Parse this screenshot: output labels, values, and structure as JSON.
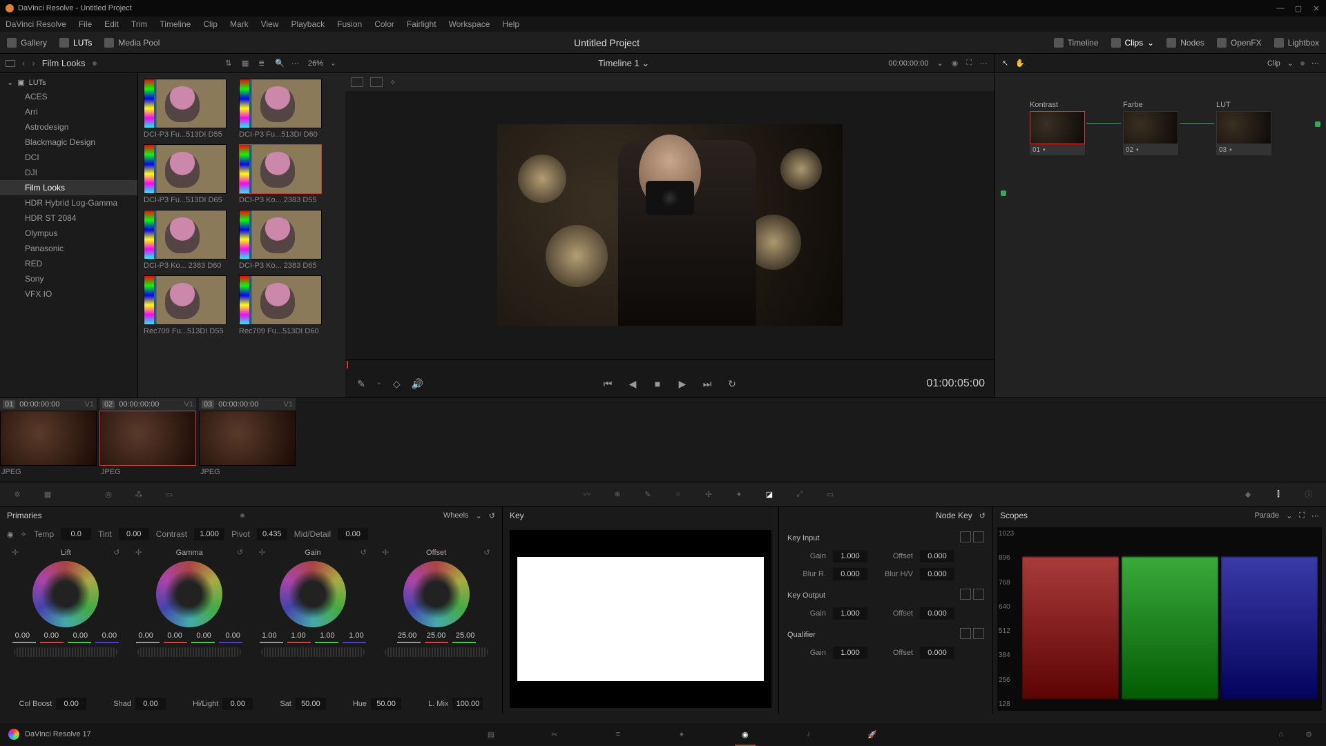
{
  "window": {
    "title": "DaVinci Resolve - Untitled Project"
  },
  "menus": [
    "DaVinci Resolve",
    "File",
    "Edit",
    "Trim",
    "Timeline",
    "Clip",
    "Mark",
    "View",
    "Playback",
    "Fusion",
    "Color",
    "Fairlight",
    "Workspace",
    "Help"
  ],
  "pagebar": {
    "left": [
      {
        "id": "gallery",
        "label": "Gallery"
      },
      {
        "id": "luts",
        "label": "LUTs",
        "active": true
      },
      {
        "id": "mediapool",
        "label": "Media Pool"
      }
    ],
    "title": "Untitled Project",
    "right": [
      {
        "id": "timeline",
        "label": "Timeline"
      },
      {
        "id": "clips",
        "label": "Clips",
        "active": true
      },
      {
        "id": "nodes",
        "label": "Nodes"
      },
      {
        "id": "openfx",
        "label": "OpenFX"
      },
      {
        "id": "lightbox",
        "label": "Lightbox"
      }
    ]
  },
  "luts": {
    "breadcrumb": "Film Looks",
    "zoom": "26%",
    "tree_root": "LUTs",
    "tree": [
      "ACES",
      "Arri",
      "Astrodesign",
      "Blackmagic Design",
      "DCI",
      "DJI",
      "Film Looks",
      "HDR Hybrid Log-Gamma",
      "HDR ST 2084",
      "Olympus",
      "Panasonic",
      "RED",
      "Sony",
      "VFX IO"
    ],
    "tree_selected": "Film Looks",
    "items": [
      {
        "label": "DCI-P3 Fu...513DI D55"
      },
      {
        "label": "DCI-P3 Fu...513DI D60"
      },
      {
        "label": "DCI-P3 Fu...513DI D65"
      },
      {
        "label": "DCI-P3 Ko... 2383 D55",
        "selected": true
      },
      {
        "label": "DCI-P3 Ko... 2383 D60"
      },
      {
        "label": "DCI-P3 Ko... 2383 D65"
      },
      {
        "label": "Rec709 Fu...513DI D55"
      },
      {
        "label": "Rec709 Fu...513DI D60"
      }
    ]
  },
  "viewer": {
    "timeline_name": "Timeline 1",
    "record_tc": "00:00:00:00",
    "timecode": "01:00:05:00"
  },
  "node_panel": {
    "mode": "Clip",
    "nodes": [
      {
        "num": "01",
        "label": "Kontrast",
        "selected": true
      },
      {
        "num": "02",
        "label": "Farbe"
      },
      {
        "num": "03",
        "label": "LUT"
      }
    ]
  },
  "clips": [
    {
      "num": "01",
      "tc": "00:00:00:00",
      "v": "V1",
      "type": "JPEG"
    },
    {
      "num": "02",
      "tc": "00:00:00:00",
      "v": "V1",
      "type": "JPEG",
      "selected": true
    },
    {
      "num": "03",
      "tc": "00:00:00:00",
      "v": "V1",
      "type": "JPEG"
    }
  ],
  "primaries": {
    "title": "Primaries",
    "mode": "Wheels",
    "adjust": {
      "Temp": "0.0",
      "Tint": "0.00",
      "Contrast": "1.000",
      "Pivot": "0.435",
      "Mid/Detail": "0.00"
    },
    "wheels": [
      {
        "name": "Lift",
        "vals": [
          "0.00",
          "0.00",
          "0.00",
          "0.00"
        ]
      },
      {
        "name": "Gamma",
        "vals": [
          "0.00",
          "0.00",
          "0.00",
          "0.00"
        ]
      },
      {
        "name": "Gain",
        "vals": [
          "1.00",
          "1.00",
          "1.00",
          "1.00"
        ]
      },
      {
        "name": "Offset",
        "vals": [
          "25.00",
          "25.00",
          "25.00"
        ]
      }
    ],
    "bottom": {
      "Col Boost": "0.00",
      "Shad": "0.00",
      "Hi/Light": "0.00",
      "Sat": "50.00",
      "Hue": "50.00",
      "L. Mix": "100.00"
    }
  },
  "key": {
    "title": "Key"
  },
  "nodekey": {
    "title": "Node Key",
    "sections": {
      "Key Input": {
        "Gain": "1.000",
        "Offset": "0.000",
        "Blur R.": "0.000",
        "Blur H/V": "0.000"
      },
      "Key Output": {
        "Gain": "1.000",
        "Offset": "0.000"
      },
      "Qualifier": {
        "Gain": "1.000",
        "Offset": "0.000"
      }
    }
  },
  "scopes": {
    "title": "Scopes",
    "mode": "Parade",
    "ylabels": [
      "1023",
      "896",
      "768",
      "640",
      "512",
      "384",
      "256",
      "128"
    ]
  },
  "footer": {
    "app": "DaVinci Resolve 17"
  }
}
